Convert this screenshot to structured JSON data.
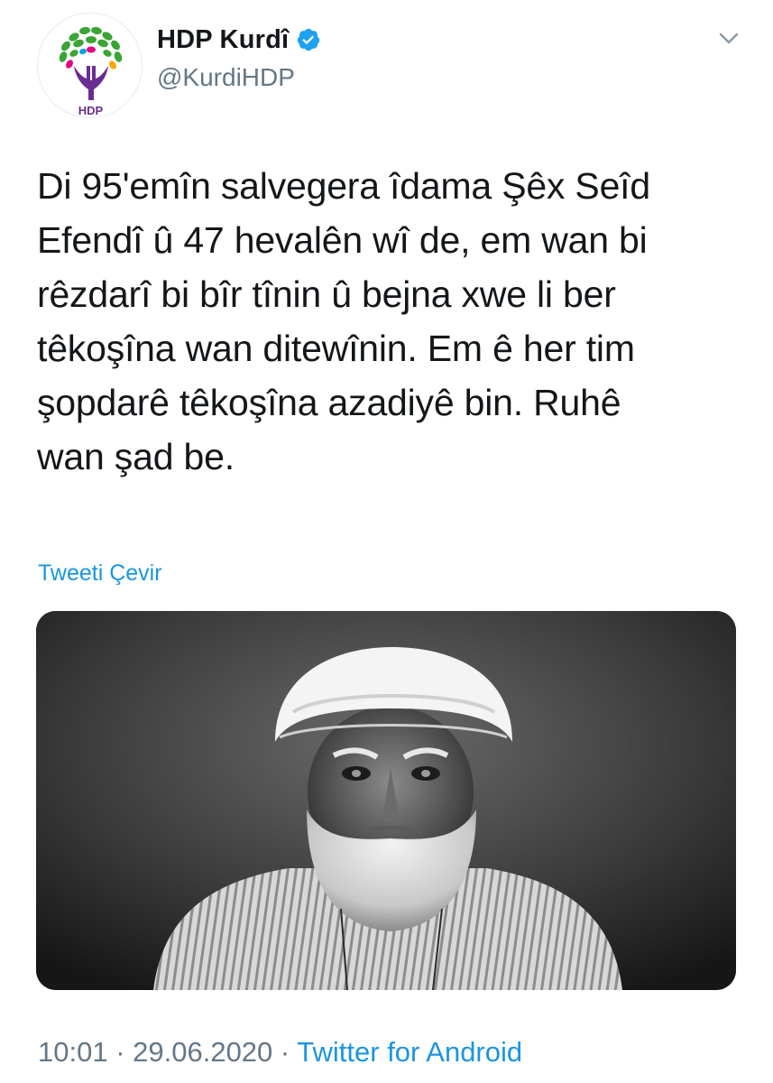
{
  "account": {
    "name": "HDP Kurdî",
    "handle": "@KurdiHDP",
    "verified": true,
    "avatar_logo_text": "HDP",
    "avatar_icon": "hdp-tree-logo-icon",
    "verified_icon": "verified-badge-icon",
    "menu_icon": "chevron-down-icon"
  },
  "tweet": {
    "text": "Di 95'emîn salvegera îdama Şêx Seîd\nEfendî û 47 hevalên wî de, em wan bi\nrêzdarî bi bîr tînin û bejna xwe li ber\ntêkoşîna wan ditewînin. Em ê her tim\nşopdarê têkoşîna azadiyê bin. Ruhê\nwan şad be.",
    "translate_label": "Tweeti Çevir",
    "time": "10:01",
    "separator1": " · ",
    "date": "29.06.2020",
    "separator2": " · ",
    "source": "Twitter for Android"
  },
  "colors": {
    "text": "#14171a",
    "secondary": "#657786",
    "link": "#1b95e0",
    "verified": "#1da1f2",
    "logo_purple": "#6a2c91",
    "logo_green": "#3aa535"
  }
}
